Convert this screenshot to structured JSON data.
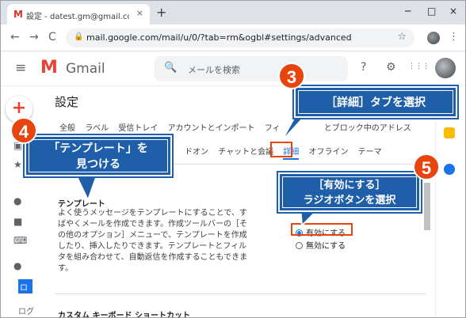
{
  "browser": {
    "tab_title": "設定 - datest.gm@gmail.com - G",
    "tab_favicon": "M",
    "tab_close": "×",
    "new_tab": "+",
    "window_controls": [
      "─",
      "□",
      "×"
    ],
    "url": "mail.google.com/mail/u/0/?tab=rm&ogbl#settings/advanced",
    "nav": {
      "back": "←",
      "forward": "→",
      "reload": "C"
    },
    "lock_icon": "🔒",
    "star": "☆",
    "menu": "⋮"
  },
  "gmail": {
    "menu_icon": "≡",
    "logo_mark": "M",
    "app_name": "Gmail",
    "search_icon": "🔍",
    "search_placeholder": "メールを検索",
    "header_icons": [
      "?",
      "⚙",
      "⋮⋮⋮"
    ]
  },
  "settings": {
    "title": "設定",
    "tabs_row1": [
      "全般",
      "ラベル",
      "受信トレイ",
      "アカウントとインポート",
      "フィ"
    ],
    "tabs_row1_tail": "とブロック中のアドレス",
    "tabs_row2": [
      "ドオン",
      "チャットと会議"
    ],
    "active_tab": "詳細",
    "tabs_row2_after": [
      "オフライン",
      "テーマ"
    ],
    "template": {
      "heading": "テンプレート",
      "description": "よく使うメッセージをテンプレートにすることで、すばやくメールを作成できます。作成ツールバーの［その他のオプション］メニューで、テンプレートを作成したり、挿入したりできます。テンプレートとフィルタを組み合わせて、自動返信を作成することもできます。",
      "option_enable": "有効にする",
      "option_disable": "無効にする",
      "selected": "有効にする"
    },
    "next_section": "カスタム キーボード ショートカット"
  },
  "left_rail": {
    "label_short": "ロ",
    "label_short2": "ログ"
  },
  "callouts": [
    {
      "number": "3",
      "text": "［詳細］タブを選択"
    },
    {
      "number": "4",
      "text_line1": "「テンプレート」を",
      "text_line2": "見つける"
    },
    {
      "number": "5",
      "text_line1": "［有効にする］",
      "text_line2": "ラジオボタンを選択"
    }
  ],
  "colors": {
    "callout_blue": "#1f5ea8",
    "number_orange": "#e8440e",
    "gmail_red": "#ea4335",
    "accent_blue": "#1a73e8"
  }
}
